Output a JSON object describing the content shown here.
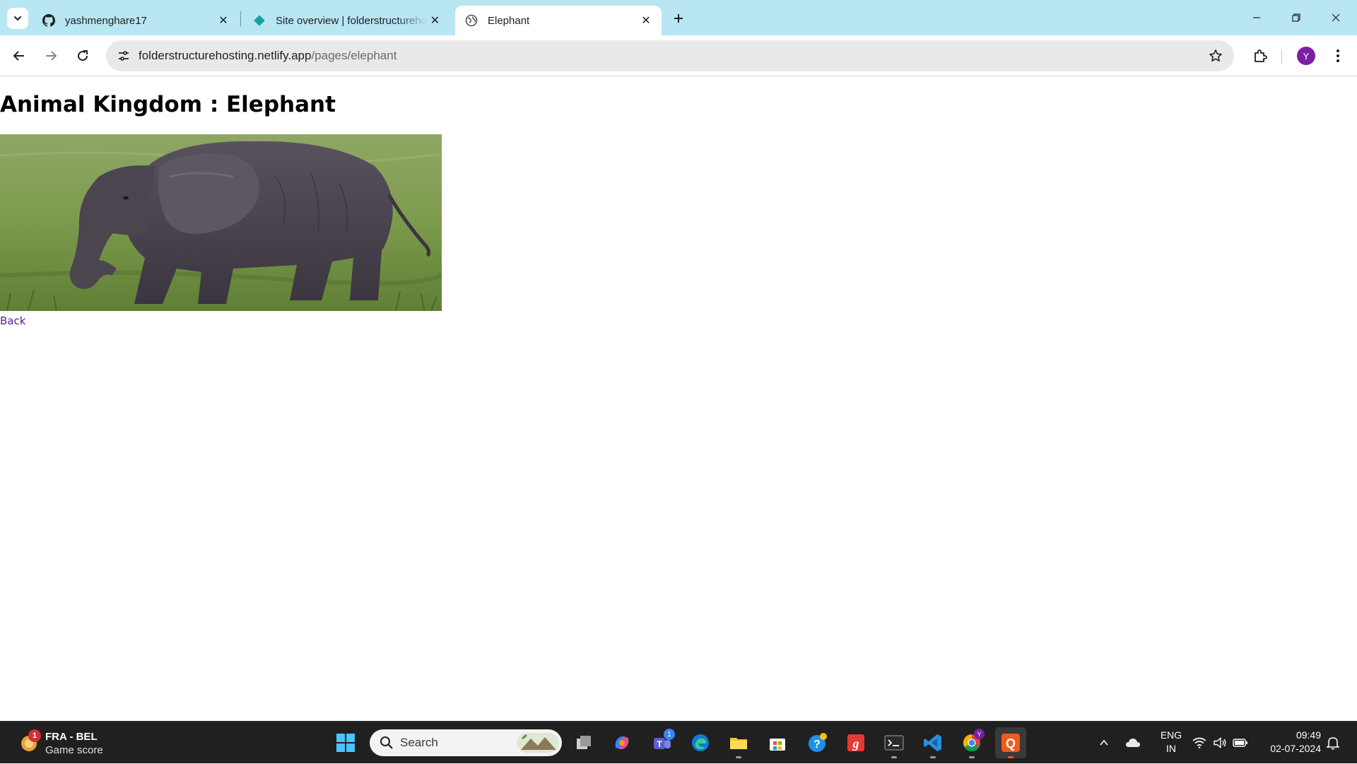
{
  "browser": {
    "tabs": [
      {
        "title": "yashmenghare17",
        "favicon": "github-icon"
      },
      {
        "title": "Site overview | folderstructurehosting",
        "favicon": "netlify-icon"
      },
      {
        "title": "Elephant",
        "favicon": "globe-icon",
        "active": true
      }
    ],
    "url_host": "folderstructurehosting.netlify.app",
    "url_path": "/pages/elephant",
    "profile_initial": "Y",
    "accent": "#b8e6f2"
  },
  "page": {
    "heading": "Animal Kingdom : Elephant",
    "image_alt": "elephant-photo",
    "back_link": "Back"
  },
  "taskbar": {
    "weather_line1": "FRA - BEL",
    "weather_line2": "Game score",
    "weather_badge": "1",
    "search_label": "Search",
    "teams_badge": "1",
    "chrome_badge": "Y",
    "language_line1": "ENG",
    "language_line2": "IN",
    "time": "09:49",
    "date": "02-07-2024"
  }
}
